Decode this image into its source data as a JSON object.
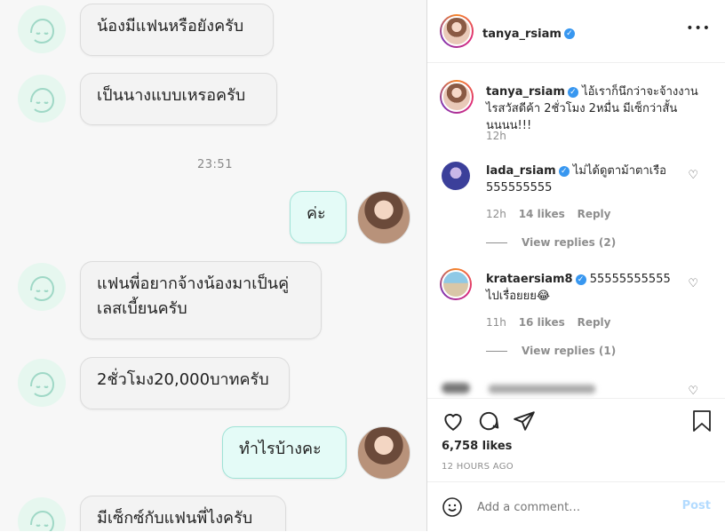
{
  "chat": {
    "messages": [
      {
        "text": "น้องมีแฟนหรือยังครับ"
      },
      {
        "text": "เป็นนางแบบเหรอครับ"
      },
      {
        "text": "ค่ะ"
      },
      {
        "text": "แฟนพี่อยากจ้างน้องมาเป็นคู่เลสเบี้ยนครับ"
      },
      {
        "text": "2ชั่วโมง20,000บาทครับ"
      },
      {
        "text": "ทำไรบ้างคะ"
      },
      {
        "text": "มีเซ็กซ์กับแฟนพี่ไงครับ"
      }
    ],
    "timestamp": "23:51"
  },
  "post": {
    "author": "tanya_rsiam",
    "more_icon": "•••",
    "caption": {
      "user": "tanya_rsiam",
      "text": "ไอ้เราก็นึกว่าจะจ้างงานไรสวัสดีค้า 2ชั่วโมง 2หมื่น มีเซ็กว่าสั้นนนนน!!!",
      "age": "12h"
    },
    "comments": [
      {
        "user": "lada_rsiam",
        "text": "ไม่ได้ดูตาม้าตาเรือ 555555555",
        "age": "12h",
        "likes": "14 likes",
        "reply": "Reply",
        "view_replies": "View replies (2)"
      },
      {
        "user": "krataersiam8",
        "text": "55555555555 ไปเรื่อยยย😂",
        "age": "11h",
        "likes": "16 likes",
        "reply": "Reply",
        "view_replies": "View replies (1)"
      }
    ],
    "likes": "6,758 likes",
    "time_ago": "12 HOURS AGO",
    "comment_placeholder": "Add a comment…",
    "post_button": "Post"
  },
  "colors": {
    "accent": "#0095f6",
    "verified": "#3897f0",
    "bubble_me": "#e4fbf7",
    "avatar_bg": "#e6f7ef"
  }
}
